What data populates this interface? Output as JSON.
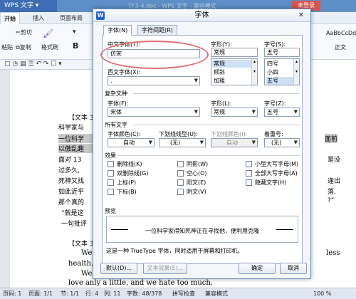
{
  "app": {
    "menu_label": "WPS 文字 ▾",
    "doc_title": "TF3-4.doc - WPS 文字 - 兼容模式",
    "login": "未登录",
    "tabs": [
      "开始",
      "插入",
      "页面布局"
    ],
    "ribbon": {
      "paste": "粘贴",
      "cut": "剪切",
      "copy": "复制",
      "format_painter": "格式刷",
      "bold": "B",
      "style_sample": "AaBbCcDd",
      "style_name": "正文"
    }
  },
  "document": {
    "lines_left": [
      "【文本 3",
      "科学家与",
      "一位科学",
      "以傲乱趣",
      "面对 13",
      "过多久,",
      "死神又找",
      "如此近乎",
      "那个真的",
      "“就是这",
      "一句批评",
      "【文本 3",
      "We",
      "health.",
      "We",
      "love anly a little, and we hate too much."
    ],
    "lines_right": [
      "面前",
      "是没",
      "逢出",
      "落,",
      "?”",
      "less"
    ]
  },
  "status": {
    "pages": "页码: 1",
    "page": "页面: 1/1",
    "section": "节: 1/1",
    "row": "行: 4",
    "col": "列: 11",
    "words": "字数: 48/378",
    "spell": "拼写检查",
    "mode": "兼容模式",
    "zoom": "100 %"
  },
  "dialog": {
    "icon": "W",
    "title": "字体",
    "close": "✕",
    "tab_font": "字体(N)",
    "tab_spacing": "字符间距(R)",
    "chinese_font_label": "中文字体(T):",
    "chinese_font_value": "仿宋",
    "western_font_label": "西文字体(X):",
    "western_font_value": ".",
    "style_label": "字形(Y):",
    "style_value": "常规",
    "style_options": [
      "常规",
      "倾斜",
      "加粗"
    ],
    "size_label": "字号(S):",
    "size_value": "五号",
    "size_options": [
      "四号",
      "小四",
      "五号"
    ],
    "complex_section": "复杂文种",
    "complex_font_label": "字体(F):",
    "complex_font_value": "宋体",
    "complex_style_label": "字形(L):",
    "complex_style_value": "常规",
    "complex_size_label": "字号(Z):",
    "complex_size_value": "五号",
    "all_text_section": "所有文字",
    "font_color_label": "字体颜色(C):",
    "font_color_value": "自动",
    "underline_label": "下划线线型(U):",
    "underline_value": "(无)",
    "underline_color_label": "下划线颜色(I):",
    "underline_color_value": "自动",
    "emphasis_label": "着重号:",
    "emphasis_value": "(无)",
    "effects_section": "效果",
    "effects": {
      "strikethrough": "删除线(K)",
      "double_strike": "双删除线(G)",
      "superscript": "上标(P)",
      "subscript": "下标(B)",
      "shadow": "阴影(W)",
      "outline": "空心(O)",
      "emboss": "阳文(E)",
      "engrave": "阴文(V)",
      "small_caps": "小型大写字母(M)",
      "all_caps": "全部大写字母(A)",
      "hidden": "隐藏文字(H)"
    },
    "preview_section": "预览",
    "preview_text": "一位科学家得知死神正在寻找他，便利用克隆",
    "truetype_note": "这是一种 TrueType 字体，同时适用于屏幕和打印机。",
    "btn_default": "默认(D)...",
    "btn_text_effects": "文本效果(E)...",
    "btn_ok": "确定",
    "btn_cancel": "取消"
  },
  "colors": {
    "titlebar": "#5d8fc6",
    "highlight_ellipse": "#e06e6e",
    "selected_item": "#cfe0f6"
  }
}
